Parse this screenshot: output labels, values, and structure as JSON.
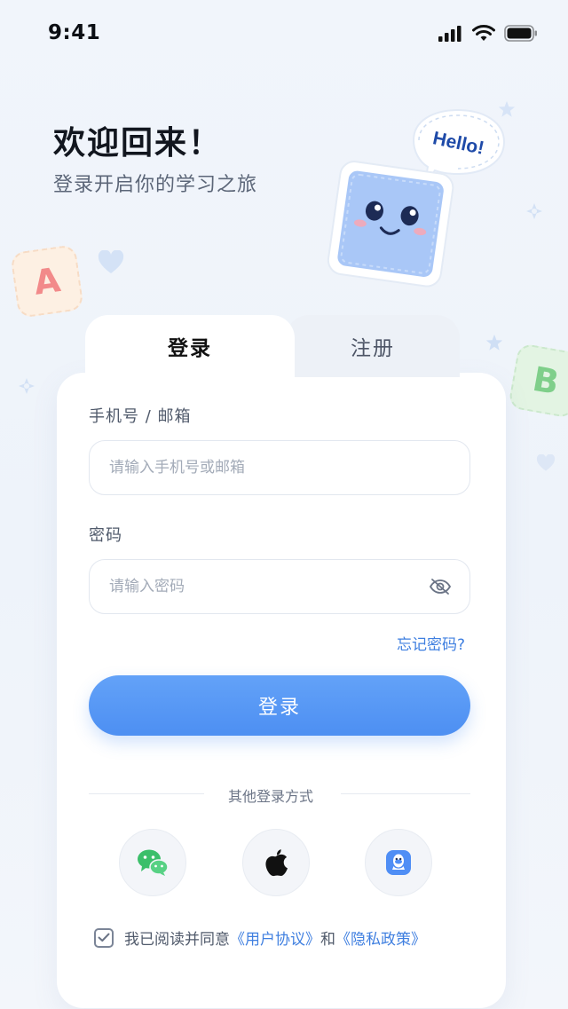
{
  "status": {
    "time": "9:41"
  },
  "hero": {
    "title": "欢迎回来！",
    "subtitle": "登录开启你的学习之旅",
    "bubble": "Hello!"
  },
  "decor": {
    "tile_a": "A",
    "tile_b": "B"
  },
  "tabs": {
    "login": "登录",
    "register": "注册"
  },
  "form": {
    "account_label": "手机号 / 邮箱",
    "account_placeholder": "请输入手机号或邮箱",
    "password_label": "密码",
    "password_placeholder": "请输入密码",
    "forgot": "忘记密码?",
    "submit": "登录"
  },
  "other_login": {
    "label": "其他登录方式",
    "options": [
      {
        "icon": "wechat-icon"
      },
      {
        "icon": "apple-icon"
      },
      {
        "icon": "qq-icon"
      }
    ]
  },
  "agreement": {
    "prefix": "我已阅读并同意",
    "user_agreement": "《用户协议》",
    "and": "和",
    "privacy_policy": "《隐私政策》",
    "checked": true
  },
  "colors": {
    "primary": "#4d8ff2",
    "link": "#3f7fe0",
    "background": "#eef3fa"
  }
}
